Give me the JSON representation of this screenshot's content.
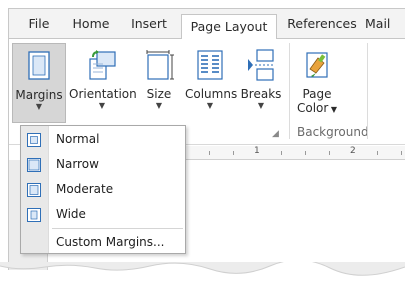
{
  "tabs": [
    {
      "label": "File",
      "active": false
    },
    {
      "label": "Home",
      "active": false
    },
    {
      "label": "Insert",
      "active": false
    },
    {
      "label": "Page Layout",
      "active": true
    },
    {
      "label": "References",
      "active": false
    },
    {
      "label": "Mail",
      "active": false
    }
  ],
  "ribbon": {
    "buttons": [
      {
        "label": "Margins",
        "icon": "margins-icon",
        "pressed": true
      },
      {
        "label": "Orientation",
        "icon": "orientation-icon",
        "pressed": false
      },
      {
        "label": "Size",
        "icon": "size-icon",
        "pressed": false
      },
      {
        "label": "Columns",
        "icon": "columns-icon",
        "pressed": false
      },
      {
        "label": "Breaks",
        "icon": "breaks-icon",
        "pressed": false
      },
      {
        "label_line1": "Page",
        "label_line2": "Color",
        "icon": "page-color-icon",
        "pressed": false
      }
    ],
    "groups": [
      "Background"
    ]
  },
  "ruler": {
    "numbers": [
      "1",
      "2"
    ]
  },
  "margins_menu": {
    "items": [
      {
        "label": "Normal",
        "icon": "margin-normal-icon"
      },
      {
        "label": "Narrow",
        "icon": "margin-narrow-icon"
      },
      {
        "label": "Moderate",
        "icon": "margin-moderate-icon"
      },
      {
        "label": "Wide",
        "icon": "margin-wide-icon"
      }
    ],
    "custom": "Custom Margins..."
  },
  "colors": {
    "icon_blue": "#2f6fb7",
    "icon_light": "#dbe8f7",
    "pressed_bg": "#d6d6d6",
    "menu_gutter": "#e8e8e8"
  }
}
